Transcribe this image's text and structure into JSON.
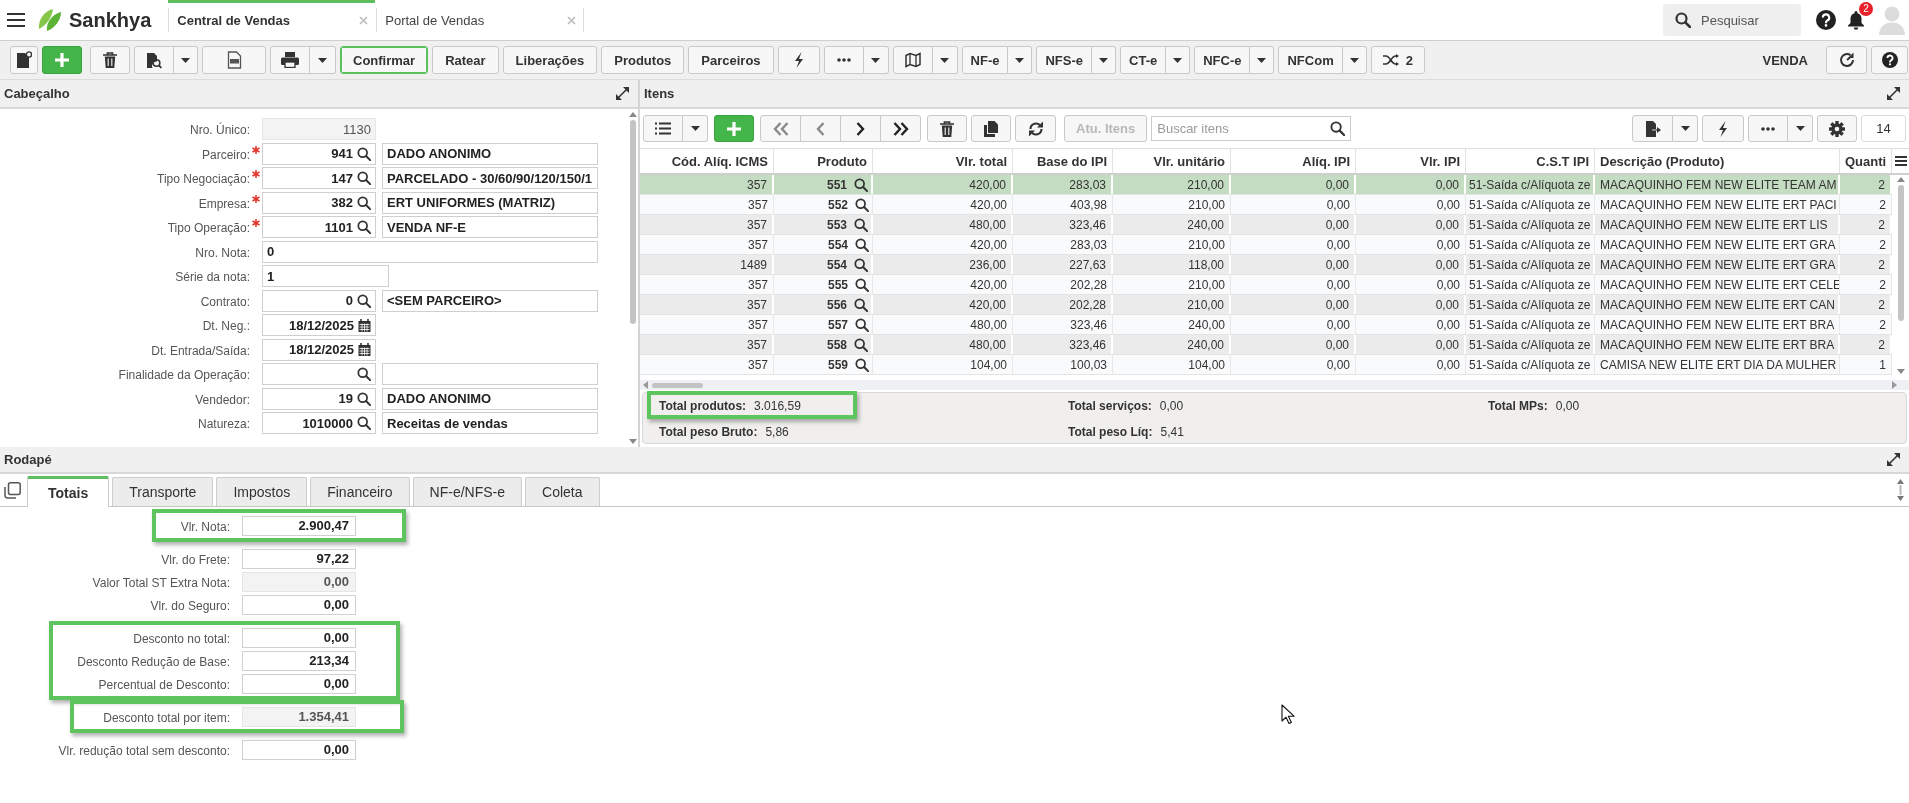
{
  "topbar": {
    "brand": "Sankhya",
    "tabs": [
      {
        "label": "Central de Vendas",
        "selected": true
      },
      {
        "label": "Portal de Vendas",
        "selected": false
      }
    ],
    "search": {
      "placeholder": "Pesquisar"
    },
    "notification_count": "2"
  },
  "toolbar": {
    "actions": [
      {
        "label": "Confirmar",
        "focused": true
      },
      {
        "label": "Ratear",
        "focused": false
      },
      {
        "label": "Liberações",
        "focused": false
      },
      {
        "label": "Produtos",
        "focused": false
      },
      {
        "label": "Parceiros",
        "focused": false
      }
    ],
    "documents": [
      {
        "label": "NF-e"
      },
      {
        "label": "NFS-e"
      },
      {
        "label": "CT-e"
      },
      {
        "label": "NFC-e"
      },
      {
        "label": "NFCom"
      }
    ],
    "shuffle_count": "2",
    "mode": "VENDA"
  },
  "header_panel": {
    "title": "Cabeçalho",
    "fields": [
      {
        "label": "Nro. Único:",
        "kind": "readonly",
        "value": "1130",
        "required": false
      },
      {
        "label": "Parceiro:",
        "kind": "lookup",
        "value": "941",
        "description": "DADO ANONIMO",
        "required": true
      },
      {
        "label": "Tipo Negociação:",
        "kind": "lookup",
        "value": "147",
        "description": "PARCELADO - 30/60/90/120/150/1",
        "required": true
      },
      {
        "label": "Empresa:",
        "kind": "lookup",
        "value": "382",
        "description": "ERT UNIFORMES (MATRIZ)",
        "required": true
      },
      {
        "label": "Tipo Operação:",
        "kind": "lookup",
        "value": "1101",
        "description": "VENDA NF-E",
        "required": true
      },
      {
        "label": "Nro. Nota:",
        "kind": "text",
        "value": "0",
        "required": false
      },
      {
        "label": "Série da nota:",
        "kind": "short",
        "value": "1",
        "required": false
      },
      {
        "label": "Contrato:",
        "kind": "lookup",
        "value": "0",
        "description": "<SEM PARCEIRO>",
        "required": false
      },
      {
        "label": "Dt. Neg.:",
        "kind": "date",
        "value": "18/12/2025",
        "required": false
      },
      {
        "label": "Dt. Entrada/Saída:",
        "kind": "date",
        "value": "18/12/2025",
        "required": false
      },
      {
        "label": "Finalidade da Operação:",
        "kind": "lookup",
        "required": false
      },
      {
        "label": "Vendedor:",
        "kind": "lookup",
        "value": "19",
        "description": "DADO ANONIMO",
        "required": false
      },
      {
        "label": "Natureza:",
        "kind": "lookup",
        "value": "1010000",
        "description": "Receitas de vendas",
        "required": false
      }
    ]
  },
  "items_panel": {
    "title": "Itens",
    "navigation": [
      {
        "disabled": true
      },
      {
        "disabled": true
      },
      {
        "disabled": false
      },
      {
        "disabled": false
      }
    ],
    "update_button": {
      "label": "Atu. Itens",
      "disabled": true
    },
    "search": {
      "placeholder": "Buscar itens"
    },
    "record_count": "14",
    "columns": [
      {
        "label": "Cód. Alíq. ICMS",
        "kind": "number"
      },
      {
        "label": "Produto",
        "kind": "lookup"
      },
      {
        "label": "Vlr. total",
        "kind": "number"
      },
      {
        "label": "Base do IPI",
        "kind": "number"
      },
      {
        "label": "Vlr. unitário",
        "kind": "number"
      },
      {
        "label": "Alíq. IPI",
        "kind": "number"
      },
      {
        "label": "Vlr. IPI",
        "kind": "number"
      },
      {
        "label": "C.S.T IPI",
        "kind": "code"
      },
      {
        "label": "Descrição (Produto)",
        "kind": "text"
      },
      {
        "label": "Quanti",
        "kind": "quantity"
      }
    ],
    "rows": [
      {
        "selected": true,
        "cells": [
          "357",
          "551",
          "420,00",
          "283,03",
          "210,00",
          "0,00",
          "0,00",
          "51-Saída c/Alíquota ze",
          "MACAQUINHO FEM NEW ELITE TEAM AM",
          "2"
        ]
      },
      {
        "selected": false,
        "cells": [
          "357",
          "552",
          "420,00",
          "403,98",
          "210,00",
          "0,00",
          "0,00",
          "51-Saída c/Alíquota ze",
          "MACAQUINHO FEM NEW ELITE ERT PACI",
          "2"
        ]
      },
      {
        "selected": false,
        "cells": [
          "357",
          "553",
          "480,00",
          "323,46",
          "240,00",
          "0,00",
          "0,00",
          "51-Saída c/Alíquota ze",
          "MACAQUINHO FEM NEW ELITE ERT LIS",
          "2"
        ]
      },
      {
        "selected": false,
        "cells": [
          "357",
          "554",
          "420,00",
          "283,03",
          "210,00",
          "0,00",
          "0,00",
          "51-Saída c/Alíquota ze",
          "MACAQUINHO FEM NEW ELITE ERT GRA",
          "2"
        ]
      },
      {
        "selected": false,
        "cells": [
          "1489",
          "554",
          "236,00",
          "227,63",
          "118,00",
          "0,00",
          "0,00",
          "51-Saída c/Alíquota ze",
          "MACAQUINHO FEM NEW ELITE ERT GRA",
          "2"
        ]
      },
      {
        "selected": false,
        "cells": [
          "357",
          "555",
          "420,00",
          "202,28",
          "210,00",
          "0,00",
          "0,00",
          "51-Saída c/Alíquota ze",
          "MACAQUINHO FEM NEW ELITE ERT CELE",
          "2"
        ]
      },
      {
        "selected": false,
        "cells": [
          "357",
          "556",
          "420,00",
          "202,28",
          "210,00",
          "0,00",
          "0,00",
          "51-Saída c/Alíquota ze",
          "MACAQUINHO FEM NEW ELITE ERT CAN",
          "2"
        ]
      },
      {
        "selected": false,
        "cells": [
          "357",
          "557",
          "480,00",
          "323,46",
          "240,00",
          "0,00",
          "0,00",
          "51-Saída c/Alíquota ze",
          "MACAQUINHO FEM NEW ELITE ERT BRA",
          "2"
        ]
      },
      {
        "selected": false,
        "cells": [
          "357",
          "558",
          "480,00",
          "323,46",
          "240,00",
          "0,00",
          "0,00",
          "51-Saída c/Alíquota ze",
          "MACAQUINHO FEM NEW ELITE ERT BRA",
          "2"
        ]
      },
      {
        "selected": false,
        "cells": [
          "357",
          "559",
          "104,00",
          "100,03",
          "104,00",
          "0,00",
          "0,00",
          "51-Saída c/Alíquota ze",
          "CAMISA NEW ELITE ERT DIA DA MULHER",
          "1"
        ]
      }
    ],
    "totals": [
      {
        "label": "Total produtos:",
        "value": "3.016,59",
        "highlighted": true
      },
      {
        "label": "Total peso Bruto:",
        "value": "5,86",
        "highlighted": false
      },
      {
        "label": "Total serviços:",
        "value": "0,00",
        "highlighted": false
      },
      {
        "label": "Total peso Líq:",
        "value": "5,41",
        "highlighted": false
      },
      {
        "label": "Total MPs:",
        "value": "0,00",
        "highlighted": false
      }
    ]
  },
  "footer_panel": {
    "title": "Rodapé",
    "tabs": [
      {
        "label": "Totais",
        "selected": true
      },
      {
        "label": "Transporte",
        "selected": false
      },
      {
        "label": "Impostos",
        "selected": false
      },
      {
        "label": "Financeiro",
        "selected": false
      },
      {
        "label": "NF-e/NFS-e",
        "selected": false
      },
      {
        "label": "Coleta",
        "selected": false
      }
    ],
    "groups": [
      {
        "highlighted": true,
        "fields": [
          {
            "label": "Vlr. Nota:",
            "value": "2.900,47",
            "kind": "input"
          }
        ]
      },
      {
        "highlighted": false,
        "fields": [
          {
            "label": "Vlr. do Frete:",
            "value": "97,22",
            "kind": "input"
          },
          {
            "label": "Valor Total ST Extra Nota:",
            "value": "0,00",
            "kind": "readonly"
          },
          {
            "label": "Vlr. do Seguro:",
            "value": "0,00",
            "kind": "input"
          }
        ]
      },
      {
        "highlighted": true,
        "fields": [
          {
            "label": "Desconto no total:",
            "value": "0,00",
            "kind": "input"
          },
          {
            "label": "Desconto Redução de Base:",
            "value": "213,34",
            "kind": "input"
          },
          {
            "label": "Percentual de Desconto:",
            "value": "0,00",
            "kind": "input"
          }
        ]
      },
      {
        "highlighted": true,
        "fields": [
          {
            "label": "Desconto total por item:",
            "value": "1.354,41",
            "kind": "readonly"
          }
        ]
      },
      {
        "highlighted": false,
        "fields": [
          {
            "label": "Vlr. redução total sem desconto:",
            "value": "0,00",
            "kind": "input"
          }
        ]
      }
    ]
  }
}
